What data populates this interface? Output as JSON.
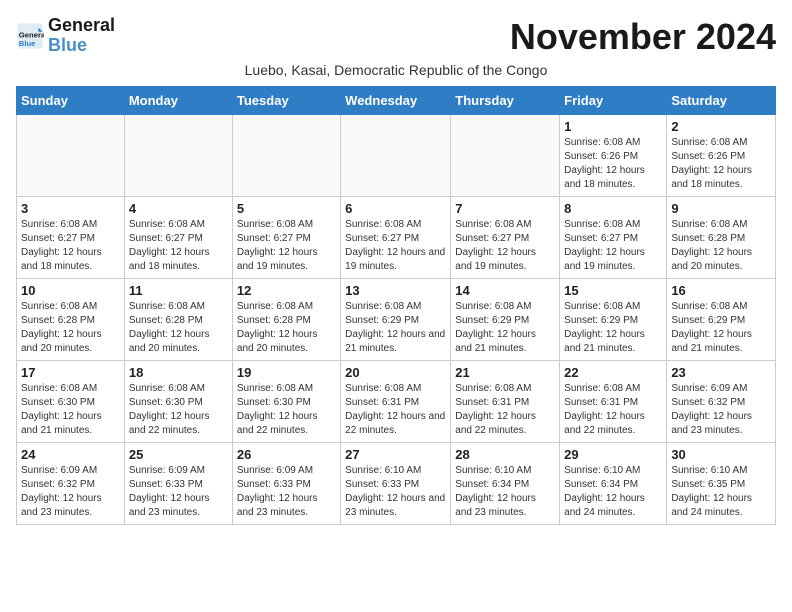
{
  "header": {
    "logo_line1": "General",
    "logo_line2": "Blue",
    "month_year": "November 2024",
    "location": "Luebo, Kasai, Democratic Republic of the Congo"
  },
  "days_of_week": [
    "Sunday",
    "Monday",
    "Tuesday",
    "Wednesday",
    "Thursday",
    "Friday",
    "Saturday"
  ],
  "weeks": [
    [
      {
        "day": "",
        "info": ""
      },
      {
        "day": "",
        "info": ""
      },
      {
        "day": "",
        "info": ""
      },
      {
        "day": "",
        "info": ""
      },
      {
        "day": "",
        "info": ""
      },
      {
        "day": "1",
        "info": "Sunrise: 6:08 AM\nSunset: 6:26 PM\nDaylight: 12 hours and 18 minutes."
      },
      {
        "day": "2",
        "info": "Sunrise: 6:08 AM\nSunset: 6:26 PM\nDaylight: 12 hours and 18 minutes."
      }
    ],
    [
      {
        "day": "3",
        "info": "Sunrise: 6:08 AM\nSunset: 6:27 PM\nDaylight: 12 hours and 18 minutes."
      },
      {
        "day": "4",
        "info": "Sunrise: 6:08 AM\nSunset: 6:27 PM\nDaylight: 12 hours and 18 minutes."
      },
      {
        "day": "5",
        "info": "Sunrise: 6:08 AM\nSunset: 6:27 PM\nDaylight: 12 hours and 19 minutes."
      },
      {
        "day": "6",
        "info": "Sunrise: 6:08 AM\nSunset: 6:27 PM\nDaylight: 12 hours and 19 minutes."
      },
      {
        "day": "7",
        "info": "Sunrise: 6:08 AM\nSunset: 6:27 PM\nDaylight: 12 hours and 19 minutes."
      },
      {
        "day": "8",
        "info": "Sunrise: 6:08 AM\nSunset: 6:27 PM\nDaylight: 12 hours and 19 minutes."
      },
      {
        "day": "9",
        "info": "Sunrise: 6:08 AM\nSunset: 6:28 PM\nDaylight: 12 hours and 20 minutes."
      }
    ],
    [
      {
        "day": "10",
        "info": "Sunrise: 6:08 AM\nSunset: 6:28 PM\nDaylight: 12 hours and 20 minutes."
      },
      {
        "day": "11",
        "info": "Sunrise: 6:08 AM\nSunset: 6:28 PM\nDaylight: 12 hours and 20 minutes."
      },
      {
        "day": "12",
        "info": "Sunrise: 6:08 AM\nSunset: 6:28 PM\nDaylight: 12 hours and 20 minutes."
      },
      {
        "day": "13",
        "info": "Sunrise: 6:08 AM\nSunset: 6:29 PM\nDaylight: 12 hours and 21 minutes."
      },
      {
        "day": "14",
        "info": "Sunrise: 6:08 AM\nSunset: 6:29 PM\nDaylight: 12 hours and 21 minutes."
      },
      {
        "day": "15",
        "info": "Sunrise: 6:08 AM\nSunset: 6:29 PM\nDaylight: 12 hours and 21 minutes."
      },
      {
        "day": "16",
        "info": "Sunrise: 6:08 AM\nSunset: 6:29 PM\nDaylight: 12 hours and 21 minutes."
      }
    ],
    [
      {
        "day": "17",
        "info": "Sunrise: 6:08 AM\nSunset: 6:30 PM\nDaylight: 12 hours and 21 minutes."
      },
      {
        "day": "18",
        "info": "Sunrise: 6:08 AM\nSunset: 6:30 PM\nDaylight: 12 hours and 22 minutes."
      },
      {
        "day": "19",
        "info": "Sunrise: 6:08 AM\nSunset: 6:30 PM\nDaylight: 12 hours and 22 minutes."
      },
      {
        "day": "20",
        "info": "Sunrise: 6:08 AM\nSunset: 6:31 PM\nDaylight: 12 hours and 22 minutes."
      },
      {
        "day": "21",
        "info": "Sunrise: 6:08 AM\nSunset: 6:31 PM\nDaylight: 12 hours and 22 minutes."
      },
      {
        "day": "22",
        "info": "Sunrise: 6:08 AM\nSunset: 6:31 PM\nDaylight: 12 hours and 22 minutes."
      },
      {
        "day": "23",
        "info": "Sunrise: 6:09 AM\nSunset: 6:32 PM\nDaylight: 12 hours and 23 minutes."
      }
    ],
    [
      {
        "day": "24",
        "info": "Sunrise: 6:09 AM\nSunset: 6:32 PM\nDaylight: 12 hours and 23 minutes."
      },
      {
        "day": "25",
        "info": "Sunrise: 6:09 AM\nSunset: 6:33 PM\nDaylight: 12 hours and 23 minutes."
      },
      {
        "day": "26",
        "info": "Sunrise: 6:09 AM\nSunset: 6:33 PM\nDaylight: 12 hours and 23 minutes."
      },
      {
        "day": "27",
        "info": "Sunrise: 6:10 AM\nSunset: 6:33 PM\nDaylight: 12 hours and 23 minutes."
      },
      {
        "day": "28",
        "info": "Sunrise: 6:10 AM\nSunset: 6:34 PM\nDaylight: 12 hours and 23 minutes."
      },
      {
        "day": "29",
        "info": "Sunrise: 6:10 AM\nSunset: 6:34 PM\nDaylight: 12 hours and 24 minutes."
      },
      {
        "day": "30",
        "info": "Sunrise: 6:10 AM\nSunset: 6:35 PM\nDaylight: 12 hours and 24 minutes."
      }
    ]
  ]
}
